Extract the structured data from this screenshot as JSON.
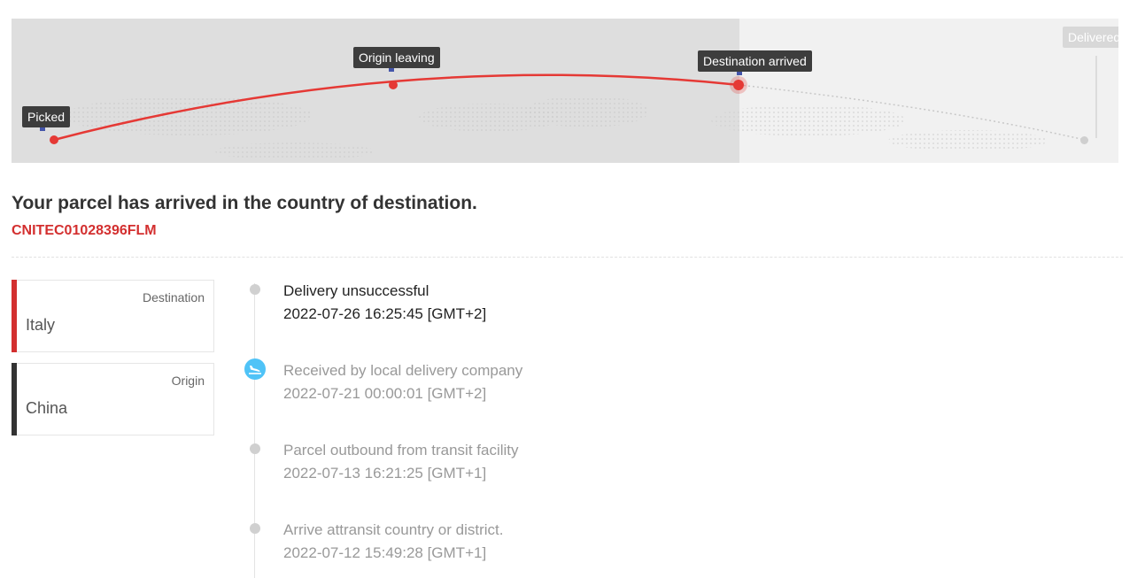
{
  "route": {
    "milestones": [
      {
        "label": "Picked",
        "state": "done"
      },
      {
        "label": "Origin leaving",
        "state": "done"
      },
      {
        "label": "Destination arrived",
        "state": "current"
      },
      {
        "label": "Delivered",
        "state": "pending"
      }
    ]
  },
  "status": {
    "title": "Your parcel has arrived in the country of destination.",
    "tracking_number": "CNITEC01028396FLM"
  },
  "locations": {
    "destination": {
      "role": "Destination",
      "country": "Italy",
      "color": "#d32f2f"
    },
    "origin": {
      "role": "Origin",
      "country": "China",
      "color": "#333333"
    }
  },
  "events": [
    {
      "description": "Delivery unsuccessful",
      "time": "2022-07-26 16:25:45 [GMT+2]",
      "icon": "dot-icon"
    },
    {
      "description": "Received by local delivery company",
      "time": "2022-07-21 00:00:01 [GMT+2]",
      "icon": "plane-landing-icon"
    },
    {
      "description": "Parcel outbound from transit facility",
      "time": "2022-07-13 16:21:25 [GMT+1]",
      "icon": "dot-icon"
    },
    {
      "description": "Arrive attransit country or district.",
      "time": "2022-07-12 15:49:28 [GMT+1]",
      "icon": "dot-icon"
    }
  ],
  "colors": {
    "accent": "#d32f2f",
    "plane_icon_bg": "#4fc3f7"
  }
}
